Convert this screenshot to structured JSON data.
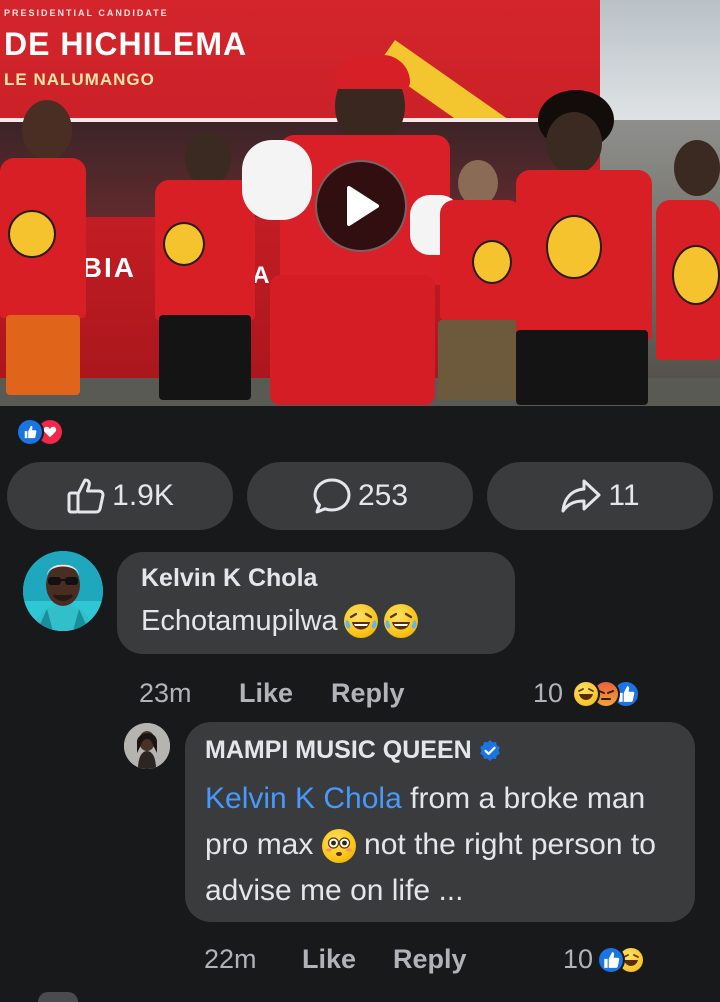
{
  "video": {
    "bus_caption_small": "PRESIDENTIAL CANDIDATE",
    "bus_title": "DE HICHILEMA",
    "bus_subtitle": "LE NALUMANGO",
    "bus_lower_text": "IBIA",
    "bus_lower_text2": "VA",
    "play_icon": "play-icon"
  },
  "reactions_summary": {
    "icons": [
      "like-reaction-icon",
      "love-reaction-icon"
    ],
    "like_color": "#1b74e4",
    "love_color": "#f02849"
  },
  "actions": {
    "like_count": "1.9K",
    "comment_count": "253",
    "share_count": "11"
  },
  "comments": [
    {
      "author": "Kelvin K Chola",
      "text": "Echotamupilwa",
      "emojis": [
        "laughing-tears-emoji",
        "laughing-tears-emoji"
      ],
      "time": "23m",
      "like_label": "Like",
      "reply_label": "Reply",
      "reaction_count": "10",
      "reaction_icons": [
        "haha-reaction-icon",
        "angry-reaction-icon",
        "like-reaction-icon"
      ]
    },
    {
      "author": "MAMPI MUSIC QUEEN",
      "verified": true,
      "mention": "Kelvin K Chola",
      "text_part1": " from a broke man pro max ",
      "emoji": "flushed-face-emoji",
      "text_part2": " not the right person to advise me on life ...",
      "time": "22m",
      "like_label": "Like",
      "reply_label": "Reply",
      "reaction_count": "10",
      "reaction_icons": [
        "like-reaction-icon",
        "haha-reaction-icon"
      ]
    }
  ],
  "colors": {
    "background": "#18191b",
    "pill": "#3a3b3c",
    "bubble": "#3a3b3c",
    "mention": "#4599ff",
    "meta_text": "#b0b3b8",
    "verified": "#1b74e4"
  }
}
